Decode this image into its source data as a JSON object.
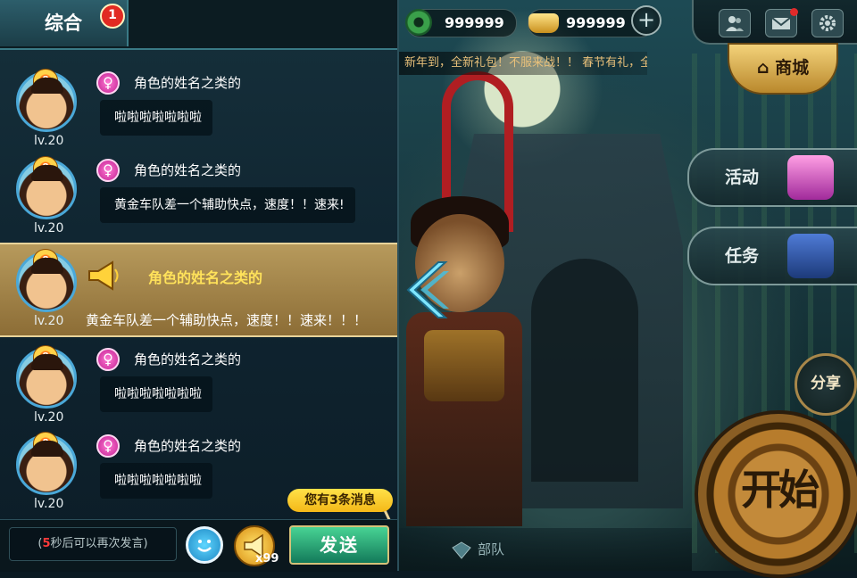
{
  "resources": {
    "jade": {
      "value": "999999",
      "icon": "jade-coin-icon"
    },
    "gold": {
      "value": "999999",
      "icon": "gold-ingot-icon"
    }
  },
  "marquee": "新年到，全新礼包！不服来战！！ 春节有礼，全新礼包！不服来战！！",
  "buttons": {
    "shop": "商城",
    "activity": "活动",
    "task": "任务",
    "share": "分享",
    "start": "开始",
    "troop": "部队"
  },
  "chat": {
    "tab": "综合",
    "unread_badge": "1",
    "messages": [
      {
        "name": "角色的姓名之类的",
        "level": "lv.20",
        "vip": "8",
        "text": "啦啦啦啦啦啦啦"
      },
      {
        "name": "角色的姓名之类的",
        "level": "lv.20",
        "vip": "8",
        "text": "黄金车队差一个辅助快点，速度！！速来!"
      },
      {
        "name": "角色的姓名之类的",
        "level": "lv.20",
        "vip": "8",
        "text": "黄金车队差一个辅助快点，速度！！速来！！！",
        "highlight": true
      },
      {
        "name": "角色的姓名之类的",
        "level": "lv.20",
        "vip": "8",
        "text": "啦啦啦啦啦啦啦"
      },
      {
        "name": "角色的姓名之类的",
        "level": "lv.20",
        "vip": "8",
        "text": "啦啦啦啦啦啦啦"
      }
    ],
    "new_messages": "您有3条消息",
    "input_countdown": "5",
    "input_placeholder": "秒后可以再次发言",
    "horn_count": "x99",
    "send": "发送"
  },
  "colors": {
    "accent_teal": "#3a7a86",
    "highlight_gold": "#b79a5c",
    "send_green": "#137a5a",
    "badge_red": "#e12a22",
    "name_yellow": "#ffe25a"
  }
}
